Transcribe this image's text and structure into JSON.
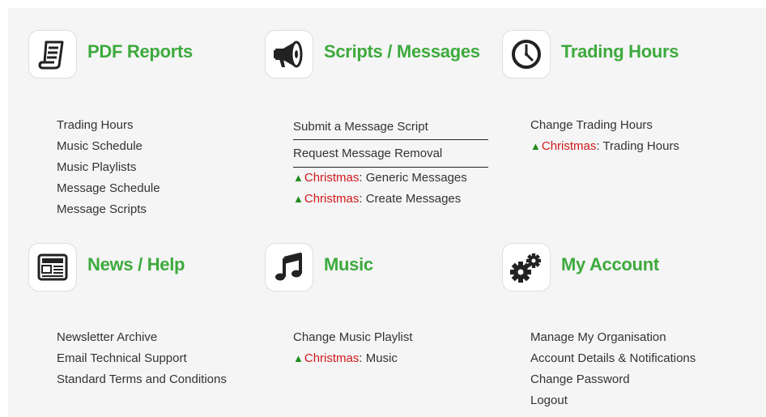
{
  "colors": {
    "title_green": "#3daa3d",
    "christmas_red": "#d01919",
    "tree_green": "#1f8b1f",
    "text": "#333333"
  },
  "sections": {
    "pdf_reports": {
      "title": "PDF Reports",
      "icon": "report-document-icon",
      "links": [
        "Trading Hours",
        "Music Schedule",
        "Music Playlists",
        "Message Schedule",
        "Message Scripts"
      ]
    },
    "scripts_messages": {
      "title": "Scripts / Messages",
      "icon": "megaphone-icon",
      "links": [
        "Submit a Message Script",
        "Request Message Removal"
      ],
      "christmas_links": [
        {
          "prefix": "Christmas",
          "suffix": ": Generic Messages"
        },
        {
          "prefix": "Christmas",
          "suffix": ": Create Messages"
        }
      ]
    },
    "trading_hours": {
      "title": "Trading Hours",
      "icon": "clock-icon",
      "links": [
        "Change Trading Hours"
      ],
      "christmas_links": [
        {
          "prefix": "Christmas",
          "suffix": ": Trading Hours"
        }
      ]
    },
    "news_help": {
      "title": "News / Help",
      "icon": "newspaper-icon",
      "links": [
        "Newsletter Archive",
        "Email Technical Support",
        "Standard Terms and Conditions"
      ]
    },
    "music": {
      "title": "Music",
      "icon": "music-note-icon",
      "links": [
        "Change Music Playlist"
      ],
      "christmas_links": [
        {
          "prefix": "Christmas",
          "suffix": ": Music"
        }
      ]
    },
    "my_account": {
      "title": "My Account",
      "icon": "gears-icon",
      "links": [
        "Manage My Organisation",
        "Account Details & Notifications",
        "Change Password",
        "Logout"
      ]
    }
  }
}
